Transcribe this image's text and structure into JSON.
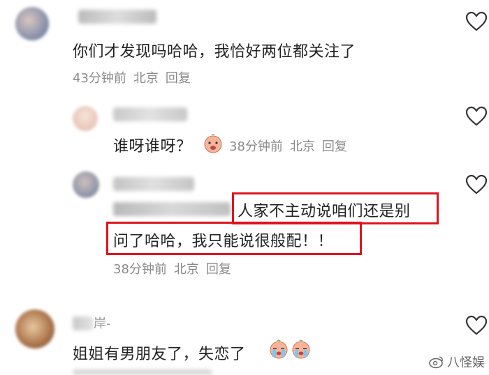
{
  "comments": [
    {
      "text": "你们才发现吗哈哈，我恰好两位都关注了",
      "time": "43分钟前",
      "location": "北京",
      "reply": "回复"
    },
    {
      "text": "谁呀谁呀？",
      "time": "38分钟前",
      "location": "北京",
      "reply": "回复"
    },
    {
      "text_line1": "人家不主动说咱们还是别",
      "text_line2": "问了哈哈，我只能说很般配！！",
      "time": "38分钟前",
      "location": "北京",
      "reply": "回复"
    },
    {
      "username_visible": "岸-",
      "text": "姐姐有男朋友了，失恋了"
    }
  ],
  "watermark": "八怪娱",
  "colors": {
    "highlight": "#e0131d",
    "meta": "#8a8a8a"
  }
}
